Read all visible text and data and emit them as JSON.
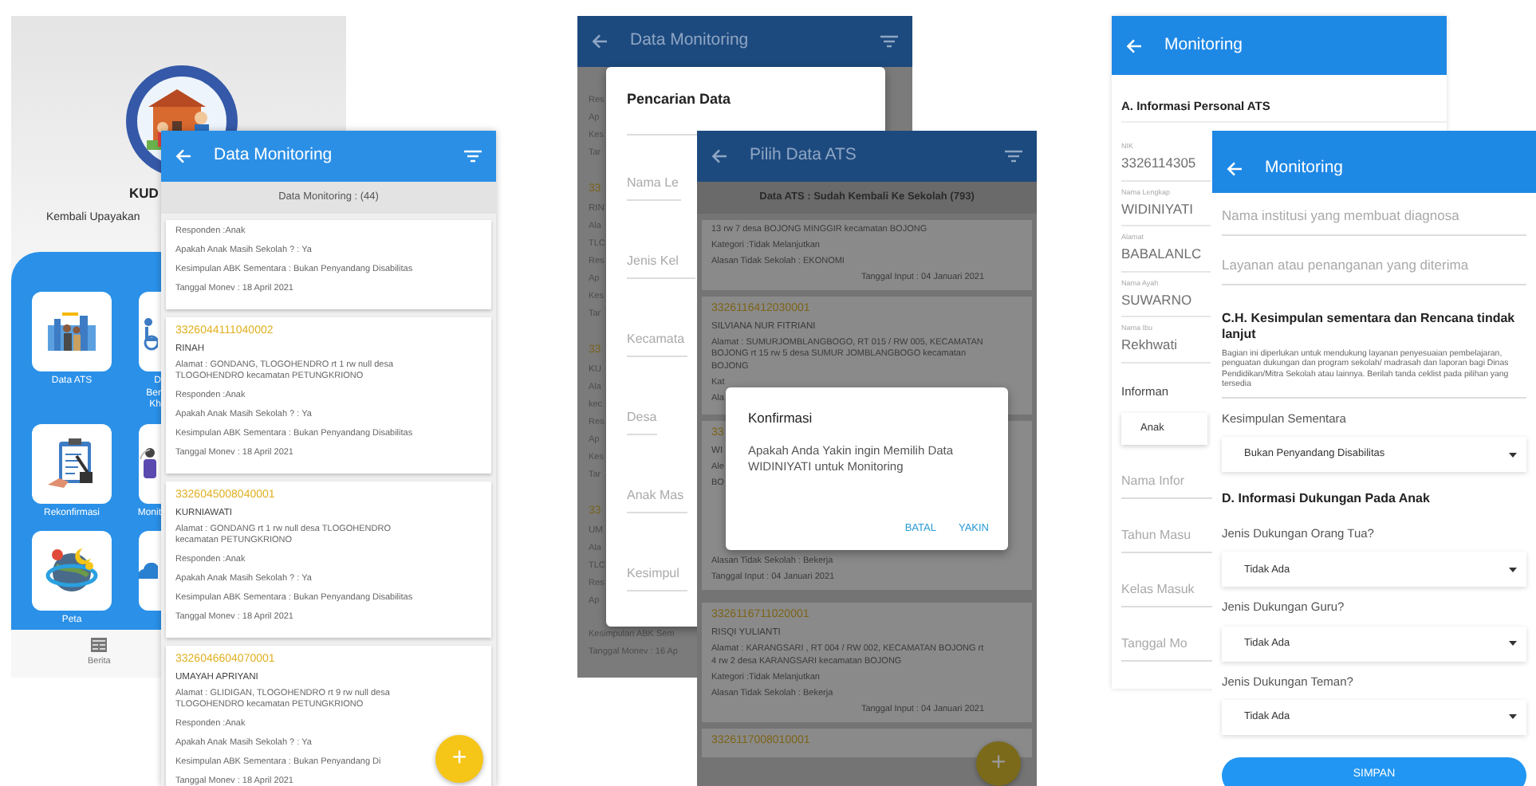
{
  "home_screen": {
    "title": "KUD",
    "subtitle": "Kembali Upayakan",
    "menu_rows": [
      {
        "tiles": [
          {
            "kind": "people",
            "lines": [
              "Data ATS"
            ]
          },
          {
            "kind": "wheelchair",
            "lines": [
              "D",
              "Ber",
              "Kh"
            ]
          }
        ]
      },
      {
        "tiles": [
          {
            "kind": "clipboard",
            "lines": [
              "Rekonfirmasi"
            ]
          },
          {
            "kind": "person",
            "lines": [
              "Monit"
            ]
          }
        ]
      },
      {
        "tiles": [
          {
            "kind": "globe",
            "lines": [
              "Peta"
            ]
          },
          {
            "kind": "cloud"
          }
        ]
      }
    ],
    "bottom_nav": [
      {
        "label": "Berita"
      }
    ]
  },
  "monitoring_list_screen": {
    "title": "Data Monitoring",
    "count_label": "Data Monitoring : (44)",
    "fab": "+",
    "cards": [
      {
        "lines": [
          "Responden :Anak",
          "Apakah Anak Masih Sekolah ? : Ya",
          "Kesimpulan ABK Sementara : Bukan Penyandang Disabilitas",
          "Tanggal Monev : 18 April 2021"
        ]
      },
      {
        "nik": "3326044111040002",
        "name": "RINAH",
        "address": "Alamat : GONDANG, TLOGOHENDRO rt 1 rw null desa TLOGOHENDRO kecamatan PETUNGKRIONO",
        "lines": [
          "Responden :Anak",
          "Apakah Anak Masih Sekolah ? : Ya",
          "Kesimpulan ABK Sementara : Bukan Penyandang Disabilitas",
          "Tanggal Monev : 18 April 2021"
        ]
      },
      {
        "nik": "3326045008040001",
        "name": "KURNIAWATI",
        "address": "Alamat : GONDANG rt 1 rw null desa TLOGOHENDRO kecamatan PETUNGKRIONO",
        "lines": [
          "Responden :Anak",
          "Apakah Anak Masih Sekolah ? : Ya",
          "Kesimpulan ABK Sementara : Bukan Penyandang Disabilitas",
          "Tanggal Monev : 18 April 2021"
        ]
      },
      {
        "nik": "3326046604070001",
        "name": "UMAYAH APRIYANI",
        "address": "Alamat : GLIDIGAN, TLOGOHENDRO rt 9 rw null desa TLOGOHENDRO kecamatan PETUNGKRIONO",
        "lines": [
          "Responden :Anak",
          "Apakah Anak Masih Sekolah ? : Ya",
          "Kesimpulan ABK Sementara : Bukan Penyandang Di",
          "Tanggal Monev : 18 April 2021"
        ]
      }
    ]
  },
  "search_screen": {
    "title": "Data Monitoring",
    "cards": [
      {
        "lines": [
          "Res",
          "Ap",
          "Kes",
          "Tar"
        ]
      },
      {
        "nik": "33",
        "name": "RIN",
        "lines": [
          "Ala",
          "TLC",
          "Res",
          "Ap",
          "Kes",
          "Tar"
        ]
      },
      {
        "nik": "33",
        "name": "KU",
        "lines": [
          "Ala",
          "kec",
          "Res",
          "Ap",
          "Kes",
          "Tar"
        ]
      },
      {
        "nik": "33",
        "name": "UM",
        "lines": [
          "Ala",
          "TLC",
          "Res",
          "Ap",
          "Kesimpulan ABK Sem",
          "Tanggal Monev : 16 Ap"
        ]
      }
    ],
    "dialog": {
      "title": "Pencarian Data",
      "fields": [
        {
          "placeholder": "Nama Le"
        },
        {
          "placeholder": "Jenis Kel"
        },
        {
          "placeholder": "Kecamata"
        },
        {
          "placeholder": "Desa"
        },
        {
          "placeholder": "Anak Mas"
        },
        {
          "placeholder": "Kesimpul"
        }
      ]
    }
  },
  "ats_list_screen": {
    "title": "Pilih Data ATS",
    "count_label": "Data ATS : Sudah Kembali Ke Sekolah (793)",
    "fab": "+",
    "cards": [
      {
        "lines": [
          "13 rw 7 desa BOJONG MINGGIR kecamatan BOJONG",
          "Kategori :Tidak Melanjutkan",
          "Alasan Tidak Sekolah : EKONOMI"
        ],
        "footer": "Tanggal Input : 04 Januari 2021"
      },
      {
        "nik": "3326116412030001",
        "name": "SILVIANA NUR FITRIANI",
        "address": "Alamat : SUMURJOMBLANGBOGO, RT 015 / RW 005, KECAMATAN BOJONG rt 15 rw 5 desa SUMUR JOMBLANGBOGO kecamatan BOJONG",
        "lines": [
          "Kat",
          "Ala"
        ]
      },
      {
        "nik": "33",
        "name": "WI",
        "lines": [
          "Ale",
          "BO",
          "Alasan Tidak Sekolah : Bekerja"
        ],
        "footer": "Tanggal Input : 04 Januari 2021"
      },
      {
        "nik": "3326116711020001",
        "name": "RISQI YULIANTI",
        "address": "Alamat : KARANGSARI , RT 004 / RW 002, KECAMATAN BOJONG rt 4 rw 2 desa KARANGSARI kecamatan BOJONG",
        "lines": [
          "Kategori :Tidak Melanjutkan",
          "Alasan Tidak Sekolah : Bekerja"
        ],
        "footer": "Tanggal Input : 04 Januari 2021"
      },
      {
        "nik": "3326117008010001"
      }
    ],
    "dialog": {
      "title": "Konfirmasi",
      "message": "Apakah Anda Yakin ingin Memilih Data WIDINIYATI untuk Monitoring",
      "buttons": [
        "BATAL",
        "YAKIN"
      ]
    }
  },
  "monitoring_form_back": {
    "title": "Monitoring",
    "section": "A. Informasi Personal ATS",
    "fields": [
      {
        "label": "NIK",
        "value": "3326114305"
      },
      {
        "label": "Nama Lengkap",
        "value": "WIDINIYATI"
      },
      {
        "label": "Alamat",
        "value": "BABALANLC"
      },
      {
        "label": "Nama Ayah",
        "value": "SUWARNO"
      },
      {
        "label": "Nama Ibu",
        "value": "Rekhwati"
      }
    ],
    "informant": {
      "label": "Informan",
      "value": "Anak"
    },
    "hint_fields": [
      {
        "placeholder": "Nama Infor"
      },
      {
        "placeholder": "Tahun Masu"
      },
      {
        "placeholder": "Kelas Masuk"
      },
      {
        "placeholder": "Tanggal Mo"
      }
    ]
  },
  "monitoring_form_front": {
    "title": "Monitoring",
    "submit": "SIMPAN",
    "items": [
      {
        "kind": "hint",
        "placeholder": "Nama institusi yang membuat diagnosa"
      },
      {
        "kind": "hint",
        "placeholder": "Layanan atau penanganan yang diterima"
      },
      {
        "kind": "heading",
        "text": "C.H. Kesimpulan sementara dan Rencana tindak lanjut"
      },
      {
        "kind": "note",
        "text": "Bagian ini diperlukan untuk mendukung layanan penyesuaian pembelajaran, penguatan dukungan dan program sekolah/ madrasah dan laporan bagi Dinas Pendidikan/Mitra Sekolah atau lainnya. Berilah tanda ceklist pada pilihan yang tersedia"
      },
      {
        "kind": "select",
        "label": "Kesimpulan Sementara",
        "value": "Bukan Penyandang Disabilitas"
      },
      {
        "kind": "heading",
        "text": "D. Informasi Dukungan Pada Anak"
      },
      {
        "kind": "select",
        "label": "Jenis Dukungan Orang Tua?",
        "value": "Tidak Ada"
      },
      {
        "kind": "select",
        "label": "Jenis Dukungan Guru?",
        "value": "Tidak Ada"
      },
      {
        "kind": "select",
        "label": "Jenis Dukungan Teman?",
        "value": "Tidak Ada"
      }
    ]
  }
}
